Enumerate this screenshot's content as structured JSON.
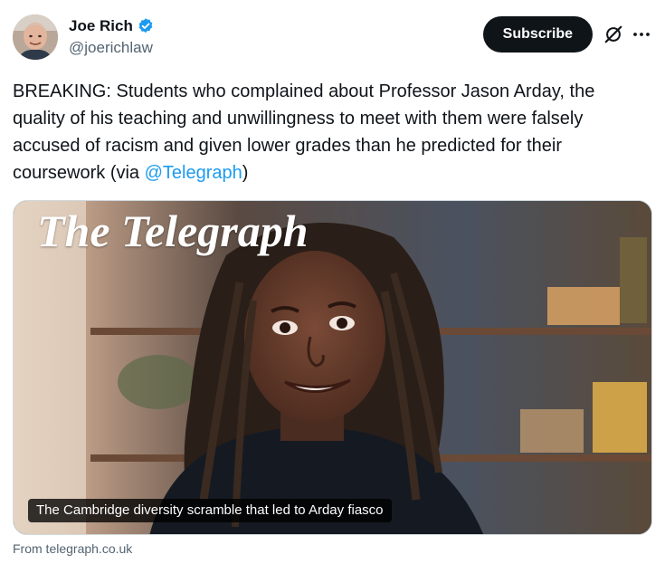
{
  "author": {
    "display_name": "Joe Rich",
    "handle": "@joerichlaw",
    "verified_icon": "verified-badge-icon",
    "verified_color": "#1d9bf0"
  },
  "actions": {
    "subscribe_label": "Subscribe",
    "grok_icon": "grok-slash-icon",
    "more_icon": "more-dots-icon"
  },
  "tweet": {
    "text_before_mention": "BREAKING: Students who complained about Professor Jason Arday, the quality of his teaching and unwillingness to meet with them were falsely accused of racism and given lower grades than he predicted for their coursework (via ",
    "mention": "@Telegraph",
    "text_after_mention": ")"
  },
  "card": {
    "masthead": "The Telegraph",
    "caption": "The Cambridge diversity scramble that led to Arday fiasco",
    "source": "From telegraph.co.uk"
  },
  "colors": {
    "text_primary": "#0f1419",
    "text_secondary": "#536471",
    "link": "#1d9bf0",
    "button_bg": "#0f1419"
  }
}
